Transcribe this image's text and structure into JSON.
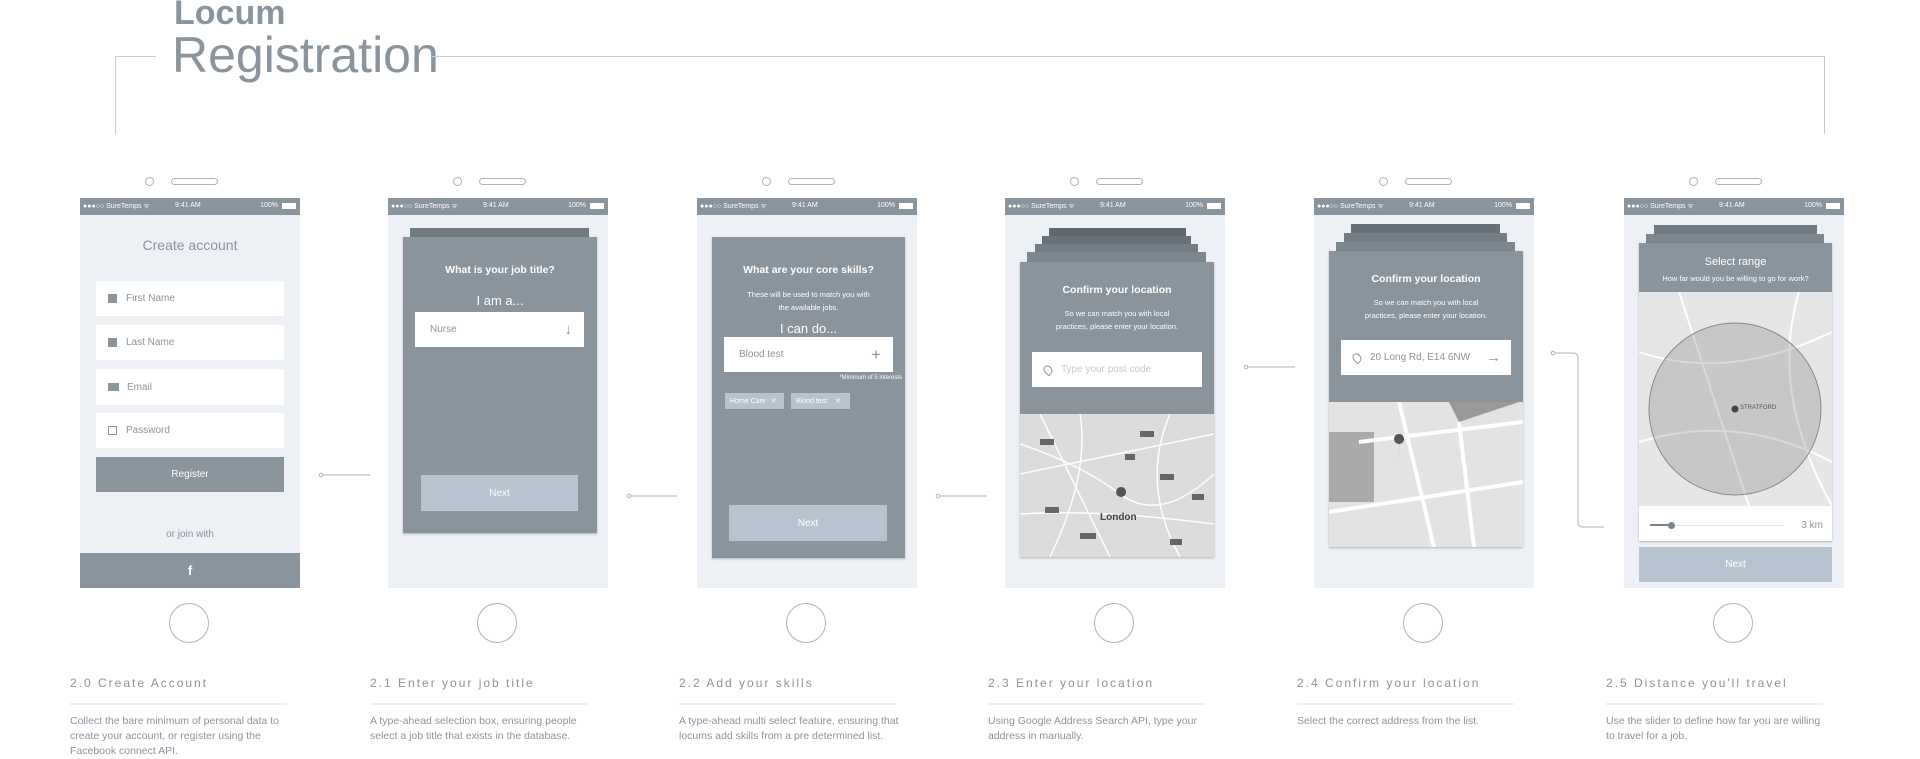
{
  "header": {
    "title_bold": "Locum",
    "title_light": "Registration"
  },
  "status_bar": {
    "carrier": "●●●○○ SureTemps ᯤ",
    "time": "9:41 AM",
    "battery": "100%"
  },
  "screens": {
    "create": {
      "title": "Create account",
      "fields": [
        "First Name",
        "Last Name",
        "Email",
        "Password"
      ],
      "register": "Register",
      "or_join": "or join with",
      "facebook": "f"
    },
    "job": {
      "title": "What is your job title?",
      "prompt": "I am a...",
      "value": "Nurse",
      "next": "Next"
    },
    "skills": {
      "title": "What are your core skills?",
      "subtitle": "These will be used to match you with the available jobs.",
      "prompt": "I can do...",
      "value": "Blood test",
      "note": "*Minimum of 5 interests",
      "chips": [
        "Home Care",
        "Blood test"
      ],
      "next": "Next"
    },
    "location": {
      "title": "Confirm your location",
      "subtitle": "So we can match you with local practices, please enter your location.",
      "placeholder": "Type your post code",
      "map_label": "London"
    },
    "confirm": {
      "title": "Confirm your location",
      "subtitle": "So we can match you with local practices, please enter your location.",
      "value": "20 Long Rd, E14 6NW"
    },
    "range": {
      "title": "Select range",
      "subtitle": "How far would you be willing to go for work?",
      "map_label": "STRATFORD",
      "value": "3 km",
      "slider_fraction": 0.16,
      "next": "Next"
    }
  },
  "steps": [
    {
      "title": "2.0 Create Account",
      "text": "Collect the bare minimum of personal data to create your account, or register using the Facebook connect API."
    },
    {
      "title": "2.1 Enter your job title",
      "text": "A type-ahead selection box, ensuring people select a job title that exists in the database."
    },
    {
      "title": "2.2 Add your skills",
      "text": "A type-ahead multi select feature, ensuring that locums add skills from a pre determined list."
    },
    {
      "title": "2.3 Enter your location",
      "text": "Using Google Address Search API, type your address in manually."
    },
    {
      "title": "2.4 Confirm your location",
      "text": "Select the correct address from the list."
    },
    {
      "title": "2.5 Distance you'll travel",
      "text": "Use the slider to define how far you are willing to travel for a job."
    }
  ],
  "colors": {
    "primary": "#89949d",
    "screen_bg": "#edf0f4",
    "button_light": "#b7c3ce"
  }
}
